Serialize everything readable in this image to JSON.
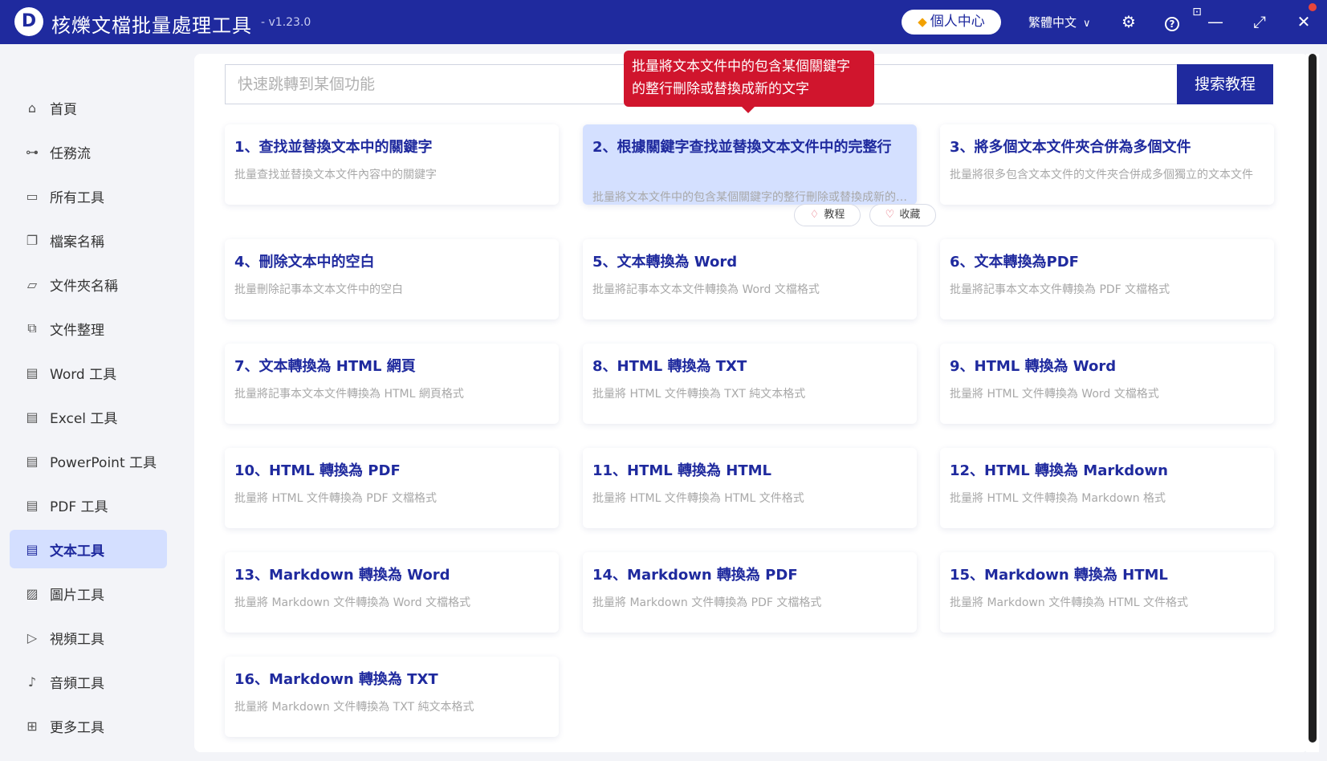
{
  "window": {
    "logo_letter": "D",
    "title": "核爍文檔批量處理工具",
    "version": "- v1.23.0",
    "profile": "個人中心",
    "language": "繁體中文",
    "icons": {
      "settings": "⚙",
      "help": "?",
      "minimize": "—",
      "maximize": "⤢",
      "close": "✕",
      "feedback": "⊡"
    }
  },
  "sidebar": {
    "items": [
      {
        "label": "首頁",
        "icon": "⌂"
      },
      {
        "label": "任務流",
        "icon": "⊶"
      },
      {
        "label": "所有工具",
        "icon": "▭"
      },
      {
        "label": "檔案名稱",
        "icon": "❐"
      },
      {
        "label": "文件夾名稱",
        "icon": "▱"
      },
      {
        "label": "文件整理",
        "icon": "⧉"
      },
      {
        "label": "Word 工具",
        "icon": "▤"
      },
      {
        "label": "Excel 工具",
        "icon": "▤"
      },
      {
        "label": "PowerPoint 工具",
        "icon": "▤"
      },
      {
        "label": "PDF 工具",
        "icon": "▤"
      },
      {
        "label": "文本工具",
        "icon": "▤"
      },
      {
        "label": "圖片工具",
        "icon": "▨"
      },
      {
        "label": "視頻工具",
        "icon": "▷"
      },
      {
        "label": "音頻工具",
        "icon": "♪"
      },
      {
        "label": "更多工具",
        "icon": "⊞"
      }
    ],
    "active_index": 10
  },
  "search": {
    "placeholder": "快速跳轉到某個功能",
    "button": "搜索教程"
  },
  "tooltip": {
    "line1": "批量將文本文件中的包含某個關鍵字",
    "line2": "的整行刪除或替換成新的文字"
  },
  "card_actions": {
    "tutorial": "教程",
    "favorite": "收藏"
  },
  "cards": [
    {
      "title": "1、查找並替換文本中的關鍵字",
      "desc": "批量查找並替換文本文件內容中的關鍵字"
    },
    {
      "title": "2、根據關鍵字查找並替換文本文件中的完整行",
      "desc": "批量將文本文件中的包含某個關鍵字的整行刪除或替換成新的文字"
    },
    {
      "title": "3、將多個文本文件夾合併為多個文件",
      "desc": "批量將很多包含文本文件的文件夾合併成多個獨立的文本文件"
    },
    {
      "title": "4、刪除文本中的空白",
      "desc": "批量刪除記事本文本文件中的空白"
    },
    {
      "title": "5、文本轉換為 Word",
      "desc": "批量將記事本文本文件轉換為 Word 文檔格式"
    },
    {
      "title": "6、文本轉換為PDF",
      "desc": "批量將記事本文本文件轉換為 PDF 文檔格式"
    },
    {
      "title": "7、文本轉換為 HTML 網頁",
      "desc": "批量將記事本文本文件轉換為 HTML 網頁格式"
    },
    {
      "title": "8、HTML 轉換為 TXT",
      "desc": "批量將 HTML 文件轉換為 TXT 純文本格式"
    },
    {
      "title": "9、HTML 轉換為 Word",
      "desc": "批量將 HTML 文件轉換為 Word 文檔格式"
    },
    {
      "title": "10、HTML 轉換為 PDF",
      "desc": "批量將 HTML 文件轉換為 PDF 文檔格式"
    },
    {
      "title": "11、HTML 轉換為 HTML",
      "desc": "批量將 HTML 文件轉換為 HTML 文件格式"
    },
    {
      "title": "12、HTML 轉換為 Markdown",
      "desc": "批量將 HTML 文件轉換為 Markdown 格式"
    },
    {
      "title": "13、Markdown 轉換為 Word",
      "desc": "批量將 Markdown 文件轉換為 Word 文檔格式"
    },
    {
      "title": "14、Markdown 轉換為 PDF",
      "desc": "批量將 Markdown 文件轉換為 PDF 文檔格式"
    },
    {
      "title": "15、Markdown 轉換為 HTML",
      "desc": "批量將 Markdown 文件轉換為 HTML 文件格式"
    },
    {
      "title": "16、Markdown 轉換為 TXT",
      "desc": "批量將 Markdown 文件轉換為 TXT 純文本格式"
    }
  ]
}
